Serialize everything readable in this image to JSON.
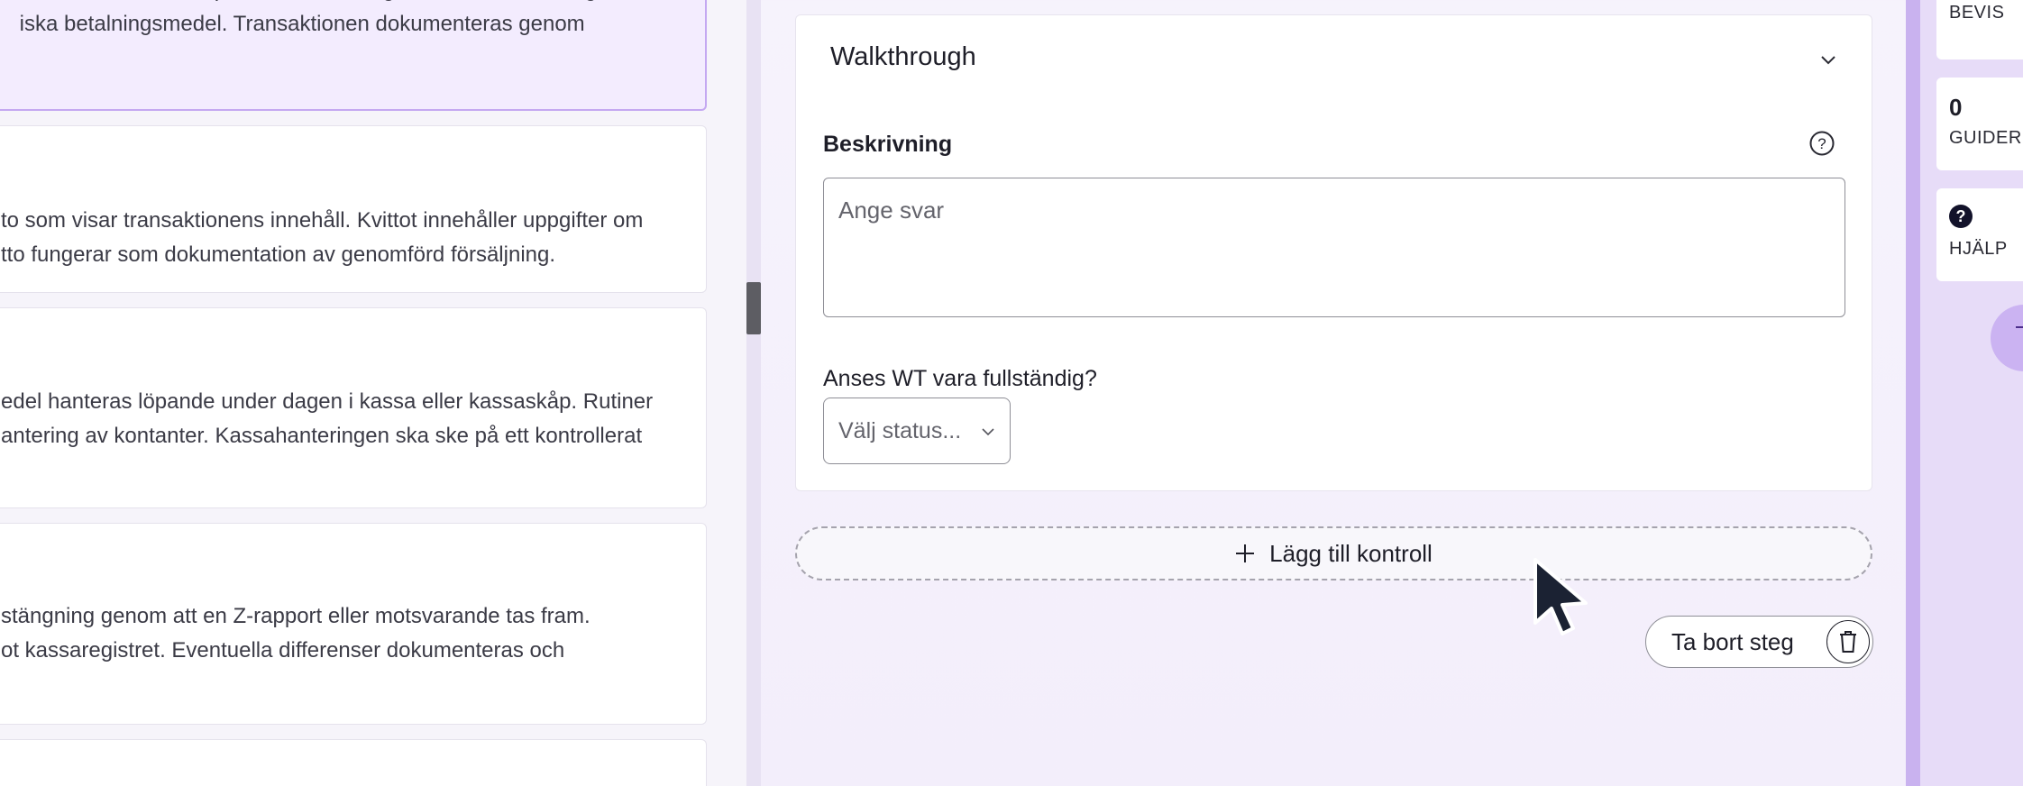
{
  "steps": [
    {
      "lines": [
        "n i samband med köptillfället. Betalning sker normalt direkt genom",
        "iska betalningsmedel. Transaktionen dokumenteras genom"
      ]
    },
    {
      "lines": [
        "to som visar transaktionens innehåll. Kvittot innehåller uppgifter om",
        "tto fungerar som dokumentation av genomförd försäljning."
      ]
    },
    {
      "lines": [
        "edel hanteras löpande under dagen i kassa eller kassaskåp. Rutiner",
        "antering av kontanter. Kassahanteringen ska ske på ett kontrollerat"
      ]
    },
    {
      "lines": [
        "stängning genom att en Z-rapport eller motsvarande tas fram.",
        "ot kassaregistret. Eventuella differenser dokumenteras och"
      ]
    }
  ],
  "walkthrough": {
    "title": "Walkthrough",
    "description_label": "Beskrivning",
    "answer_placeholder": "Ange svar",
    "question": "Anses WT vara fullständig?",
    "status_placeholder": "Välj status..."
  },
  "actions": {
    "add_control": "Lägg till kontroll",
    "remove_step": "Ta bort steg"
  },
  "rail": {
    "evidence_label": "BEVIS",
    "guides_count": "0",
    "guides_label": "GUIDER",
    "help_icon_glyph": "?",
    "help_label": "HJÄLP"
  },
  "icons": {
    "chevron": "chevron-down-icon",
    "help": "help-circle-icon",
    "plus": "plus-icon",
    "trash": "trash-icon",
    "cursor": "mouse-pointer-icon"
  },
  "colors": {
    "accent": "#c4a8f1",
    "rail": "#e7dcf8",
    "selected_card": "#f3ecfe"
  }
}
